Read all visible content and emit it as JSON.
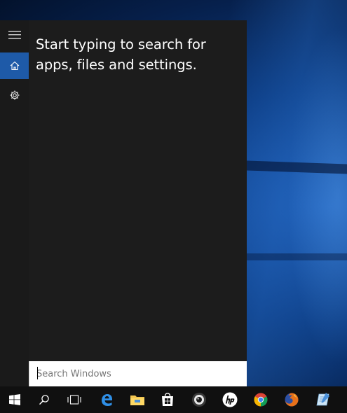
{
  "start_panel": {
    "prompt_line1": "Start typing to search for",
    "prompt_line2": "apps, files and settings.",
    "rail": {
      "menu_icon": "hamburger-menu-icon",
      "home_icon": "home-icon",
      "settings_icon": "gear-icon"
    }
  },
  "search": {
    "placeholder": "Search Windows",
    "value": ""
  },
  "taskbar": {
    "items": [
      {
        "name": "start-button",
        "icon": "windows-logo-icon"
      },
      {
        "name": "search-button",
        "icon": "search-icon"
      },
      {
        "name": "task-view-button",
        "icon": "task-view-icon"
      },
      {
        "name": "edge-button",
        "icon": "edge-icon"
      },
      {
        "name": "file-explorer-button",
        "icon": "folder-icon"
      },
      {
        "name": "store-button",
        "icon": "store-icon"
      },
      {
        "name": "webcam-app-button",
        "icon": "webcam-icon"
      },
      {
        "name": "hp-button",
        "icon": "hp-icon"
      },
      {
        "name": "chrome-button",
        "icon": "chrome-icon"
      },
      {
        "name": "firefox-button",
        "icon": "firefox-icon"
      },
      {
        "name": "notepad-button",
        "icon": "notepad-icon"
      }
    ]
  },
  "colors": {
    "accent": "#1e5aa8",
    "panel": "#1c1c1c",
    "rail": "#1a1a1a",
    "taskbar": "#101010"
  }
}
